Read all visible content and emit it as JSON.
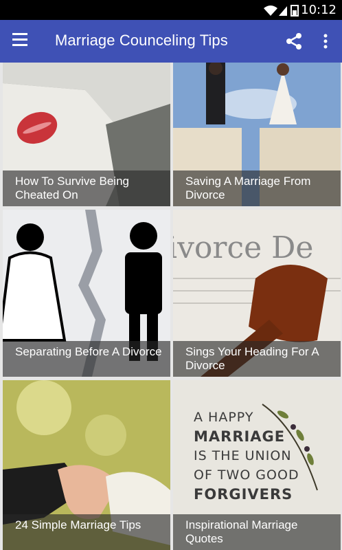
{
  "status_bar": {
    "time": "10:12"
  },
  "app_bar": {
    "title": "Marriage Counceling Tips"
  },
  "articles": [
    {
      "title": "How To Survive Being Cheated On"
    },
    {
      "title": "Saving A Marriage From Divorce"
    },
    {
      "title": "Separating Before A Divorce"
    },
    {
      "title": "Sings Your Heading For A Divorce"
    },
    {
      "title": "24 Simple Marriage Tips"
    },
    {
      "title": "Inspirational Marriage Quotes"
    }
  ],
  "images": {
    "gavel_document_text": "ivorce De",
    "quote_lines": [
      "A HAPPY",
      "MARRIAGE",
      "IS THE UNION",
      "OF TWO GOOD",
      "FORGIVERS"
    ]
  },
  "colors": {
    "app_bar": "#3f51b5",
    "status_bar": "#000000"
  }
}
